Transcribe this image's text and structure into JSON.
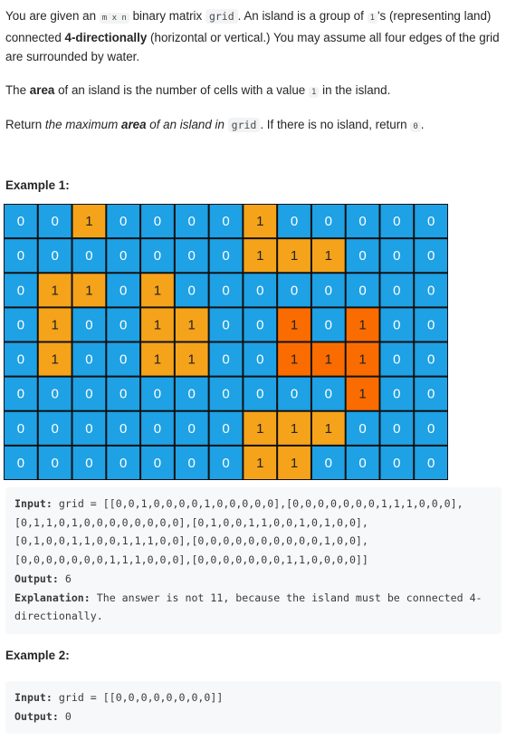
{
  "description": {
    "p1": {
      "t1": "You are given an ",
      "c1": "m x n",
      "t2": " binary matrix ",
      "c2": "grid",
      "t3": ". An island is a group of ",
      "c3": "1",
      "t4": "'s (representing land) connected ",
      "b1": "4-directionally",
      "t5": " (horizontal or vertical.) You may assume all four edges of the grid are surrounded by water."
    },
    "p2": {
      "t1": "The ",
      "b1": "area",
      "t2": " of an island is the number of cells with a value ",
      "c1": "1",
      "t3": " in the island."
    },
    "p3": {
      "t1": "Return ",
      "e1": "the maximum ",
      "eb1": "area",
      "e2": " of an island in ",
      "c1": "grid",
      "t2": ". If there is no island, return ",
      "c2": "0",
      "t3": "."
    }
  },
  "example1": {
    "label": "Example 1:",
    "grid": [
      [
        0,
        0,
        1,
        0,
        0,
        0,
        0,
        1,
        0,
        0,
        0,
        0,
        0
      ],
      [
        0,
        0,
        0,
        0,
        0,
        0,
        0,
        1,
        1,
        1,
        0,
        0,
        0
      ],
      [
        0,
        1,
        1,
        0,
        1,
        0,
        0,
        0,
        0,
        0,
        0,
        0,
        0
      ],
      [
        0,
        1,
        0,
        0,
        1,
        1,
        0,
        0,
        1,
        0,
        1,
        0,
        0
      ],
      [
        0,
        1,
        0,
        0,
        1,
        1,
        0,
        0,
        1,
        1,
        1,
        0,
        0
      ],
      [
        0,
        0,
        0,
        0,
        0,
        0,
        0,
        0,
        0,
        0,
        1,
        0,
        0
      ],
      [
        0,
        0,
        0,
        0,
        0,
        0,
        0,
        1,
        1,
        1,
        0,
        0,
        0
      ],
      [
        0,
        0,
        0,
        0,
        0,
        0,
        0,
        1,
        1,
        0,
        0,
        0,
        0
      ]
    ],
    "highlight": [
      [
        3,
        8
      ],
      [
        3,
        10
      ],
      [
        4,
        8
      ],
      [
        4,
        9
      ],
      [
        4,
        10
      ],
      [
        5,
        10
      ]
    ],
    "colors": {
      "water": "#1ea1e5",
      "land": "#f5a31a",
      "highlight": "#fb6c00",
      "border": "#111111",
      "text": "#222222",
      "water_text": "#ffffff"
    },
    "input_label": "Input:",
    "input_value": "grid = [[0,0,1,0,0,0,0,1,0,0,0,0,0],[0,0,0,0,0,0,0,1,1,1,0,0,0],[0,1,1,0,1,0,0,0,0,0,0,0,0],[0,1,0,0,1,1,0,0,1,0,1,0,0],[0,1,0,0,1,1,0,0,1,1,1,0,0],[0,0,0,0,0,0,0,0,0,0,1,0,0],[0,0,0,0,0,0,0,1,1,1,0,0,0],[0,0,0,0,0,0,0,1,1,0,0,0,0]]",
    "output_label": "Output:",
    "output_value": "6",
    "explanation_label": "Explanation:",
    "explanation_value": "The answer is not 11, because the island must be connected 4-directionally."
  },
  "example2": {
    "label": "Example 2:",
    "input_label": "Input:",
    "input_value": "grid = [[0,0,0,0,0,0,0,0]]",
    "output_label": "Output:",
    "output_value": "0"
  }
}
